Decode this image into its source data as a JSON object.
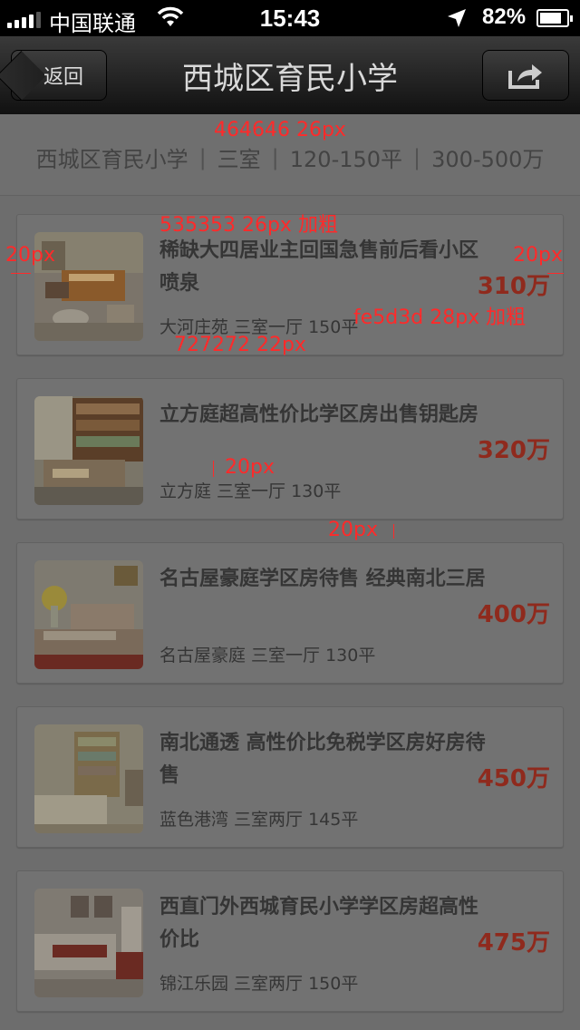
{
  "status_bar": {
    "carrier": "中国联通",
    "time": "15:43",
    "battery": "82%",
    "battery_level": 0.82
  },
  "nav": {
    "back_label": "返回",
    "title": "西城区育民小学",
    "share_icon": "share-icon"
  },
  "filter": {
    "items": [
      "西城区育民小学",
      "三室",
      "120-150平",
      "300-500万"
    ]
  },
  "listings": [
    {
      "title": "稀缺大四居业主回国急售前后看小区喷泉",
      "meta": "大河庄苑 三室一厅 150平",
      "price": "310万"
    },
    {
      "title": "立方庭超高性价比学区房出售钥匙房",
      "meta": "立方庭 三室一厅 130平",
      "price": "320万"
    },
    {
      "title": "名古屋豪庭学区房待售 经典南北三居",
      "meta": "名古屋豪庭 三室一厅 130平",
      "price": "400万"
    },
    {
      "title": "南北通透 高性价比免税学区房好房待售",
      "meta": "蓝色港湾 三室两厅 145平",
      "price": "450万"
    },
    {
      "title": "西直门外西城育民小学学区房超高性价比",
      "meta": "锦江乐园 三室两厅 150平",
      "price": "475万"
    }
  ],
  "annotations": {
    "filter_spec": "464646 26px",
    "title_spec": "535353 26px 加粗",
    "left_margin": "20px",
    "right_margin": "20px",
    "price_spec": "fe5d3d 28px 加粗",
    "meta_spec": "727272 22px",
    "thumb_gap": "20px",
    "card_gap": "20px"
  },
  "colors": {
    "price": "#fe5d3d",
    "title": "#535353",
    "meta": "#727272",
    "filter": "#464646",
    "annotation": "#ff2a2a"
  }
}
